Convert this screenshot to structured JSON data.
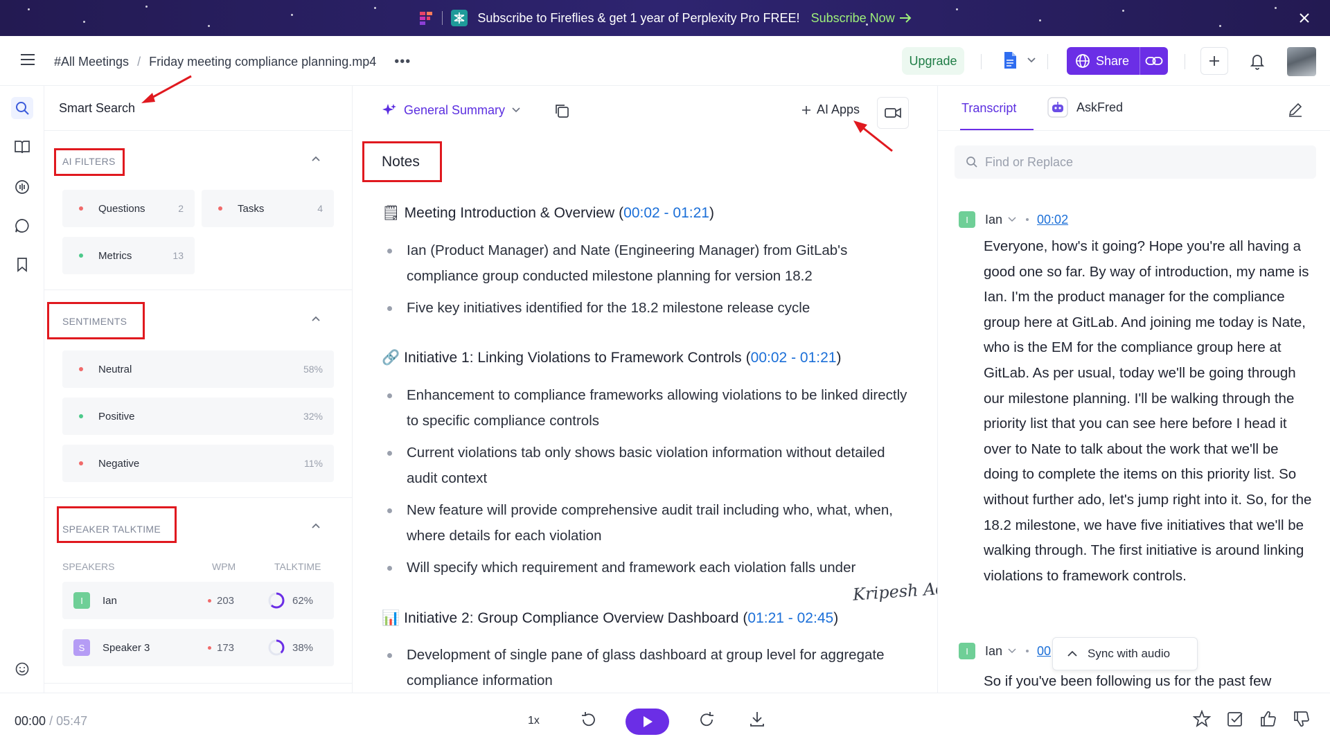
{
  "banner": {
    "text": "Subscribe to Fireflies & get 1 year of Perplexity Pro FREE!",
    "cta": "Subscribe Now"
  },
  "header": {
    "breadcrumb_root": "#All Meetings",
    "breadcrumb_sep": "/",
    "file_name": "Friday meeting compliance planning.mp4",
    "more": "•••",
    "upgrade": "Upgrade",
    "share": "Share"
  },
  "smart_search": {
    "title": "Smart Search",
    "ai_filters": {
      "label": "AI FILTERS",
      "items": [
        {
          "label": "Questions",
          "count": "2",
          "color": "#f06a6a"
        },
        {
          "label": "Tasks",
          "count": "4",
          "color": "#f06a6a"
        },
        {
          "label": "Metrics",
          "count": "13",
          "color": "#4cc98a"
        }
      ]
    },
    "sentiments": {
      "label": "SENTIMENTS",
      "items": [
        {
          "label": "Neutral",
          "value": "58%",
          "color": "#f06a6a"
        },
        {
          "label": "Positive",
          "value": "32%",
          "color": "#4cc98a"
        },
        {
          "label": "Negative",
          "value": "11%",
          "color": "#f06a6a"
        }
      ]
    },
    "speaker_talktime": {
      "label": "SPEAKER TALKTIME",
      "columns": [
        "SPEAKERS",
        "WPM",
        "TALKTIME"
      ],
      "speakers": [
        {
          "initial": "I",
          "name": "Ian",
          "wpm": "203",
          "talktime": "62%",
          "talk_fraction": 0.62,
          "color": "#6fcf97"
        },
        {
          "initial": "S",
          "name": "Speaker 3",
          "wpm": "173",
          "talktime": "38%",
          "talk_fraction": 0.38,
          "color": "#b59cf5"
        }
      ]
    }
  },
  "notes": {
    "summary_label": "General Summary",
    "ai_apps": "AI Apps",
    "title": "Notes",
    "sections": [
      {
        "emoji": "🗒",
        "heading": "Meeting Introduction & Overview",
        "ts_start": "00:02",
        "ts_end": "01:21",
        "bullets": [
          "Ian (Product Manager) and Nate (Engineering Manager) from GitLab's compliance group conducted milestone planning for version 18.2",
          "Five key initiatives identified for the 18.2 milestone release cycle"
        ]
      },
      {
        "emoji": "🔗",
        "heading": "Initiative 1: Linking Violations to Framework Controls",
        "ts_start": "00:02",
        "ts_end": "01:21",
        "bullets": [
          "Enhancement to compliance frameworks allowing violations to be linked directly to specific compliance controls",
          "Current violations tab only shows basic violation information without detailed audit context",
          "New feature will provide comprehensive audit trail including who, what, when, where details for each violation",
          "Will specify which requirement and framework each violation falls under"
        ]
      },
      {
        "emoji": "📊",
        "heading": "Initiative 2: Group Compliance Overview Dashboard",
        "ts_start": "01:21",
        "ts_end": "02:45",
        "bullets": [
          "Development of single pane of glass dashboard at group level for aggregate compliance information"
        ]
      }
    ],
    "signature": "Kripesh Adwani"
  },
  "transcript": {
    "tab_transcript": "Transcript",
    "tab_askfred": "AskFred",
    "find_placeholder": "Find or Replace",
    "entries": [
      {
        "initial": "I",
        "speaker": "Ian",
        "timestamp": "00:02",
        "text": "Everyone, how's it going? Hope you're all having a good one so far. By way of introduction, my name is Ian. I'm the product manager for the compliance group here at GitLab. And joining me today is Nate, who is the EM for the compliance group here at GitLab. As per usual, today we'll be going through our milestone planning. I'll be walking through the priority list that you can see here before I head it over to Nate to talk about the work that we'll be doing to complete the items on this priority list. So without further ado, let's jump right into it. So, for the 18.2 milestone, we have five initiatives that we'll be walking through. The first initiative is around linking violations to framework controls."
      },
      {
        "initial": "I",
        "speaker": "Ian",
        "timestamp": "00",
        "text": "So if you've been following us for the past few"
      }
    ],
    "sync_label": "Sync with audio"
  },
  "player": {
    "current": "00:00",
    "sep": "/",
    "duration": "05:47",
    "speed": "1x"
  },
  "colors": {
    "accent": "#6b2ee6",
    "timestamp": "#1b6fd8",
    "annotation": "#e0191f"
  }
}
